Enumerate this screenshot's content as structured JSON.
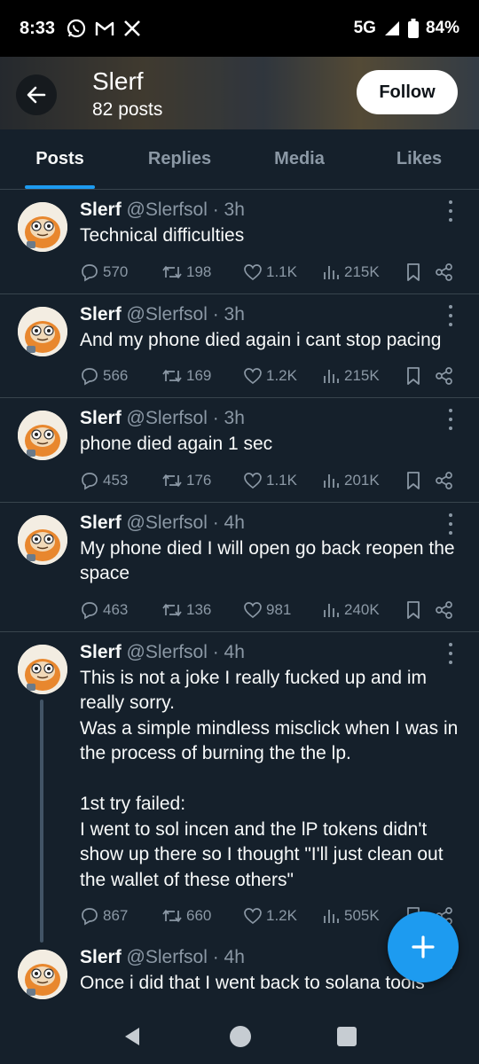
{
  "status_bar": {
    "time": "8:33",
    "icons_left": [
      "whatsapp-icon",
      "gmail-icon",
      "x-icon"
    ],
    "network": "5G",
    "battery": "84%"
  },
  "header": {
    "title": "Slerf",
    "subtitle": "82 posts",
    "follow_label": "Follow"
  },
  "tabs": [
    {
      "label": "Posts",
      "active": true
    },
    {
      "label": "Replies",
      "active": false
    },
    {
      "label": "Media",
      "active": false
    },
    {
      "label": "Likes",
      "active": false
    }
  ],
  "posts": [
    {
      "name": "Slerf",
      "handle": "@Slerfsol",
      "time": "· 3h",
      "text": "Technical difficulties",
      "replies": "570",
      "reposts": "198",
      "likes": "1.1K",
      "views": "215K"
    },
    {
      "name": "Slerf",
      "handle": "@Slerfsol",
      "time": "· 3h",
      "text": "And my phone died again i cant stop pacing",
      "replies": "566",
      "reposts": "169",
      "likes": "1.2K",
      "views": "215K"
    },
    {
      "name": "Slerf",
      "handle": "@Slerfsol",
      "time": "· 3h",
      "text": "phone died again 1 sec",
      "replies": "453",
      "reposts": "176",
      "likes": "1.1K",
      "views": "201K"
    },
    {
      "name": "Slerf",
      "handle": "@Slerfsol",
      "time": "· 4h",
      "text": "My phone died I will open go back reopen the space",
      "replies": "463",
      "reposts": "136",
      "likes": "981",
      "views": "240K"
    },
    {
      "name": "Slerf",
      "handle": "@Slerfsol",
      "time": "· 4h",
      "text": "This is not a joke I really fucked up and im really sorry.\nWas a simple mindless misclick when I was in the process of burning the the lp.\n\n1st try failed:\nI went to sol incen and the lP tokens didn't show up there so I thought \"I'll just clean out the wallet of these others\"",
      "replies": "867",
      "reposts": "660",
      "likes": "1.2K",
      "views": "505K"
    },
    {
      "name": "Slerf",
      "handle": "@Slerfsol",
      "time": "· 4h",
      "text": "Once i did that I went back to solana tools",
      "replies": "",
      "reposts": "",
      "likes": "",
      "views": ""
    }
  ],
  "colors": {
    "background": "#15202b",
    "accent": "#1d9bf0",
    "muted": "#8b98a5",
    "divider": "#38444d"
  }
}
